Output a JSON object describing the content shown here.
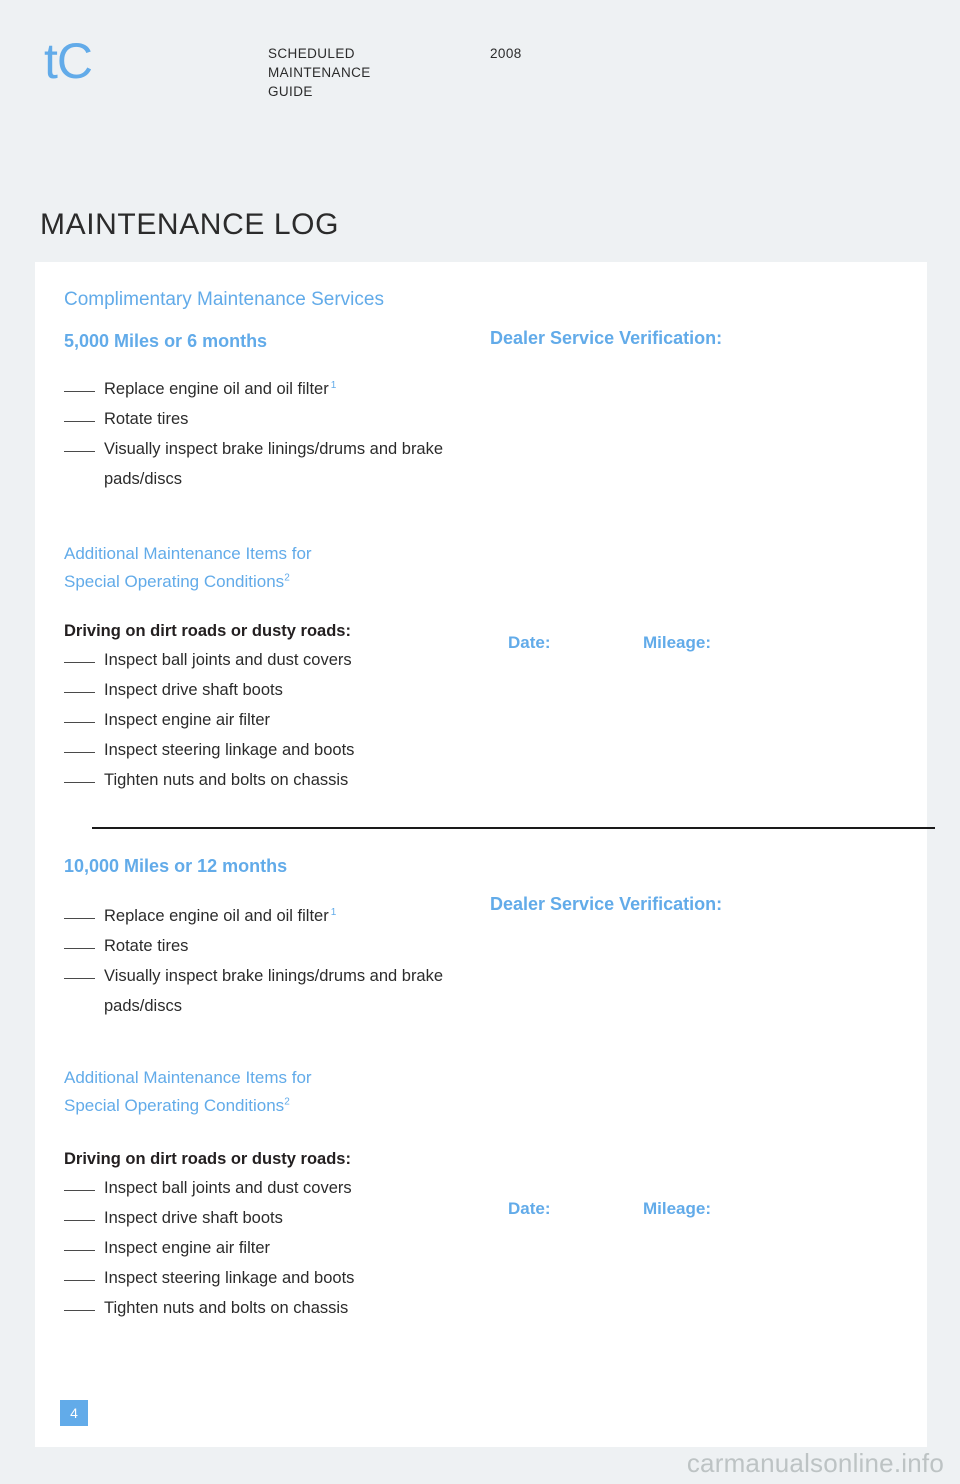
{
  "header": {
    "model_logo": "tC",
    "guide_title": "SCHEDULED MAINTENANCE GUIDE",
    "year": "2008",
    "page_title": "MAINTENANCE LOG"
  },
  "colors": {
    "accent_blue": "#62abe9",
    "page_background": "#eef1f3",
    "sheet_background": "#ffffff",
    "body_text": "#2b2b2b",
    "divider": "#1a1a1a",
    "watermark": "#bdc3c4"
  },
  "sheet": {
    "section_title": "Complimentary Maintenance Services",
    "special_conditions_heading_line1": "Additional Maintenance Items for",
    "special_conditions_heading_line2": "Special Operating Conditions",
    "special_conditions_footnote": "2",
    "dirt_roads_heading": "Driving on dirt roads or dusty roads:",
    "dealer_verification_label": "Dealer Service Verification:",
    "date_label": "Date:",
    "mileage_label": "Mileage:",
    "intervals": [
      {
        "title": "5,000 Miles or 6 months",
        "items": [
          {
            "text": "Replace engine oil and oil filter",
            "footnote": "1"
          },
          {
            "text": "Rotate tires",
            "footnote": ""
          },
          {
            "text": "Visually inspect brake linings/drums and brake pads/discs",
            "footnote": ""
          }
        ],
        "special_items": [
          "Inspect ball joints and dust covers",
          "Inspect drive shaft boots",
          "Inspect engine air filter",
          "Inspect steering linkage and boots",
          "Tighten nuts and bolts on chassis"
        ]
      },
      {
        "title": "10,000 Miles or 12 months",
        "items": [
          {
            "text": "Replace engine oil and oil filter",
            "footnote": "1"
          },
          {
            "text": "Rotate tires",
            "footnote": ""
          },
          {
            "text": "Visually inspect brake linings/drums and brake pads/discs",
            "footnote": ""
          }
        ],
        "special_items": [
          "Inspect ball joints and dust covers",
          "Inspect drive shaft boots",
          "Inspect engine air filter",
          "Inspect steering linkage and boots",
          "Tighten nuts and bolts on chassis"
        ]
      }
    ]
  },
  "footer": {
    "page_number": "4",
    "watermark": "carmanualsonline.info"
  }
}
